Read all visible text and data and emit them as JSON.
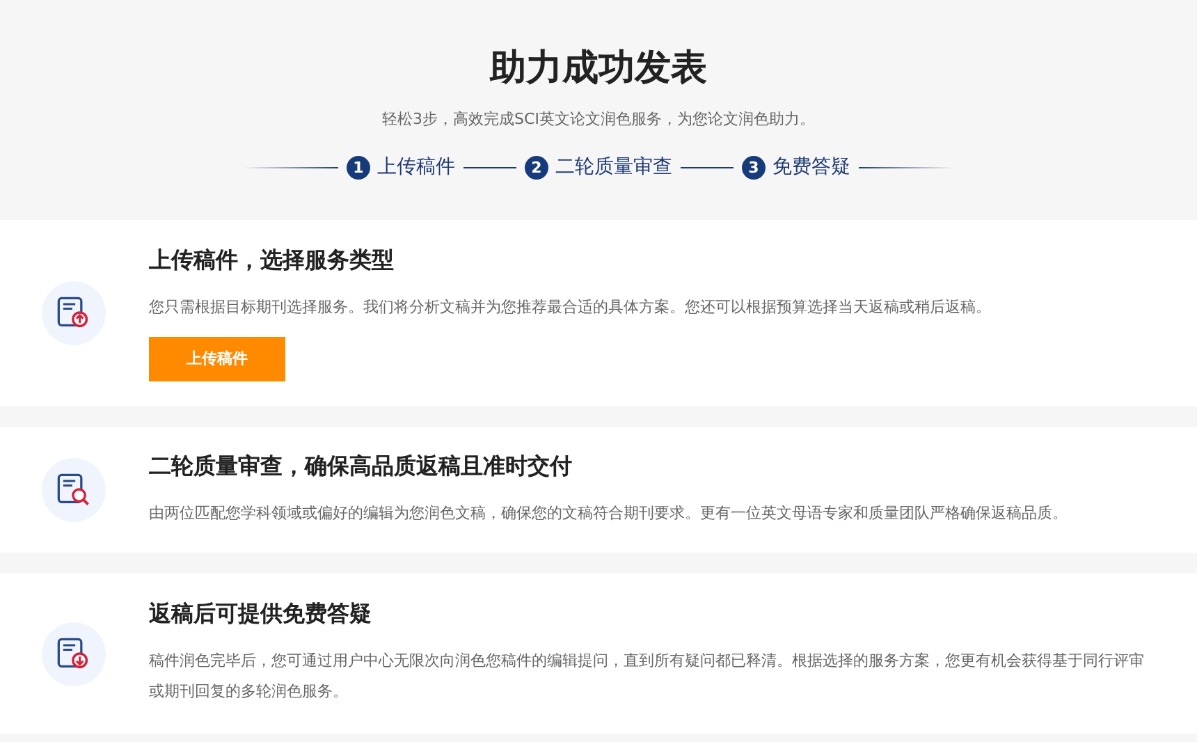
{
  "header": {
    "title": "助力成功发表",
    "subtitle": "轻松3步，高效完成SCI英文论文润色服务，为您论文润色助力。",
    "steps": [
      {
        "number": "1",
        "label": "上传稿件"
      },
      {
        "number": "2",
        "label": "二轮质量审查"
      },
      {
        "number": "3",
        "label": "免费答疑"
      }
    ]
  },
  "cards": [
    {
      "title": "上传稿件，选择服务类型",
      "description": "您只需根据目标期刊选择服务。我们将分析文稿并为您推荐最合适的具体方案。您还可以根据预算选择当天返稿或稍后返稿。",
      "button": "上传稿件"
    },
    {
      "title": "二轮质量审查，确保高品质返稿且准时交付",
      "description": "由两位匹配您学科领域或偏好的编辑为您润色文稿，确保您的文稿符合期刊要求。更有一位英文母语专家和质量团队严格确保返稿品质。"
    },
    {
      "title": "返稿后可提供免费答疑",
      "description": "稿件润色完毕后，您可通过用户中心无限次向润色您稿件的编辑提问，直到所有疑问都已释清。根据选择的服务方案，您更有机会获得基于同行评审或期刊回复的多轮润色服务。"
    }
  ]
}
